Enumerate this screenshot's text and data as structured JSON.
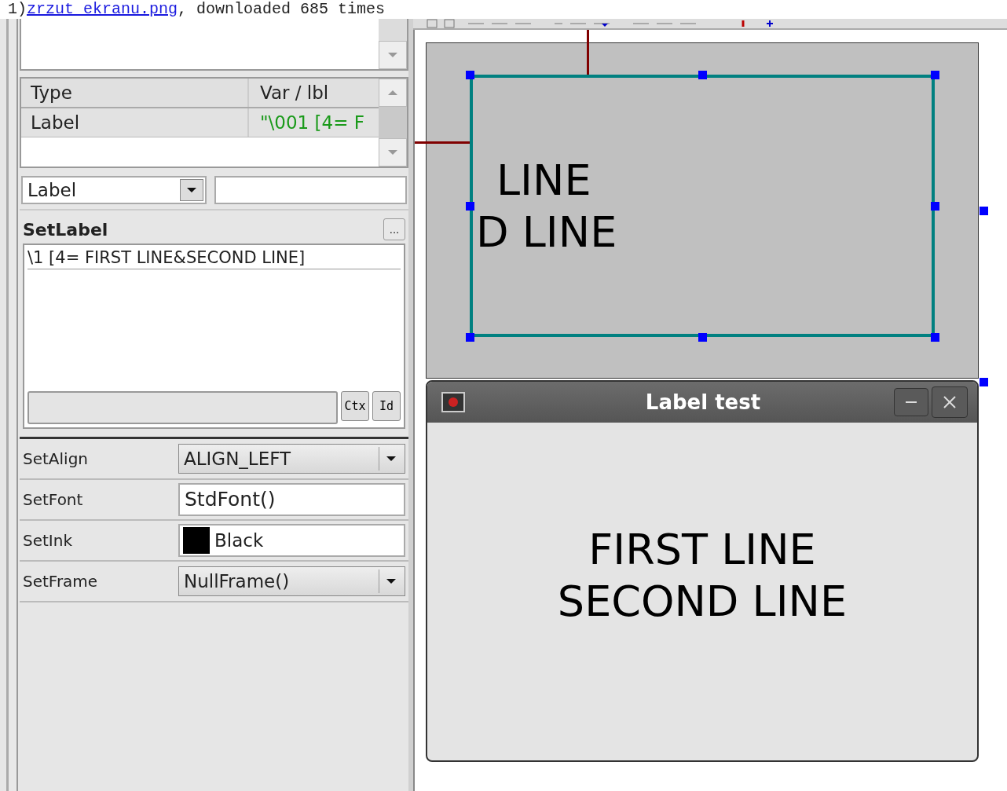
{
  "caption": {
    "index": "1)",
    "link": "zrzut_ekranu.png",
    "rest": ", downloaded 685 times"
  },
  "table": {
    "columns": [
      "Type",
      "Var / lbl"
    ],
    "rows": [
      {
        "type": "Label",
        "var": "\"\\001 [4= F",
        "selected": true
      }
    ]
  },
  "class_select": {
    "value": "Label"
  },
  "set_label": {
    "title": "SetLabel",
    "more_button": "...",
    "text": "\\1 [4= FIRST LINE&SECOND LINE]",
    "buttons": [
      "Ctx",
      "Id"
    ]
  },
  "properties": [
    {
      "name": "SetAlign",
      "kind": "dropdown",
      "value": "ALIGN_LEFT"
    },
    {
      "name": "SetFont",
      "kind": "text",
      "value": "StdFont()"
    },
    {
      "name": "SetInk",
      "kind": "color",
      "value": "Black",
      "color": "#000000"
    },
    {
      "name": "SetFrame",
      "kind": "dropdown",
      "value": "NullFrame()"
    }
  ],
  "canvas": {
    "label_lines": [
      "LINE",
      "D LINE"
    ]
  },
  "preview_window": {
    "title": "Label test",
    "lines": [
      "FIRST LINE",
      "SECOND LINE"
    ]
  }
}
